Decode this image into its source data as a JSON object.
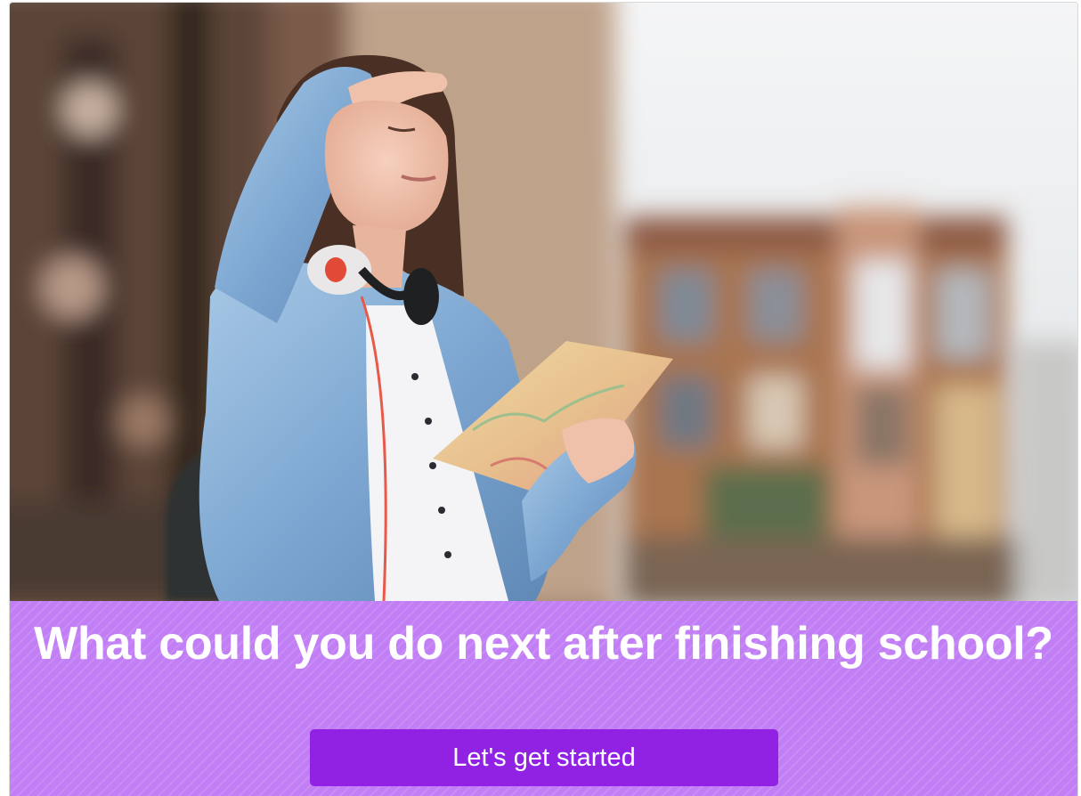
{
  "hero": {
    "image_name": "traveller-with-map-photo",
    "colors": {
      "sky": "#eef1f3",
      "building": "#a9754f",
      "tree_shadow": "#4a3a33",
      "jacket": "#86b0d6",
      "map": "#e6bd86"
    }
  },
  "band": {
    "headline": "What could you do next after finishing school?",
    "background": "#c27ff5"
  },
  "cta": {
    "label": "Let's get started",
    "background": "#9122e3"
  }
}
